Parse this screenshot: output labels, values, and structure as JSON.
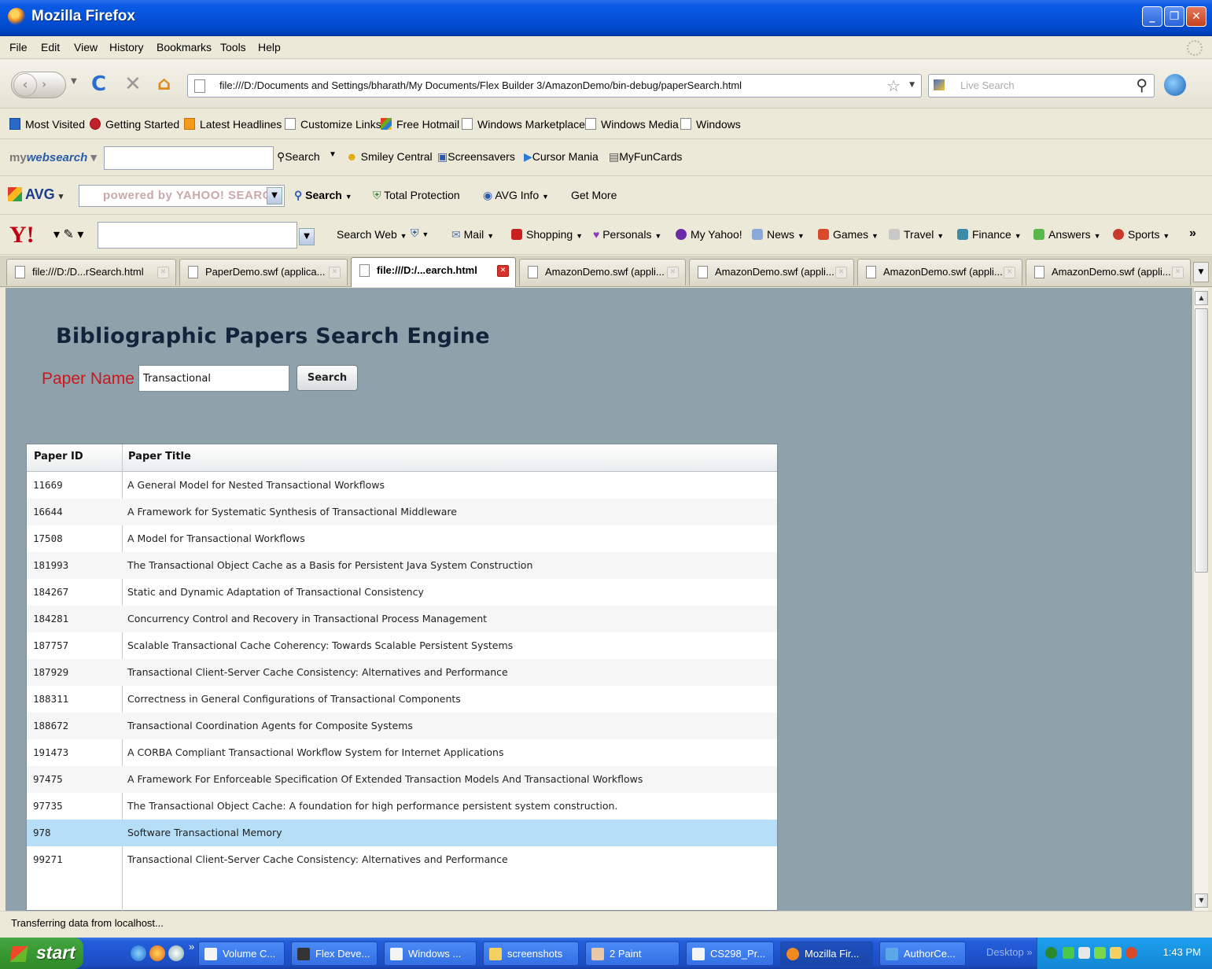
{
  "window": {
    "title": "Mozilla Firefox"
  },
  "menu": [
    "File",
    "Edit",
    "View",
    "History",
    "Bookmarks",
    "Tools",
    "Help"
  ],
  "nav": {
    "url": "file:///D:/Documents and Settings/bharath/My Documents/Flex Builder 3/AmazonDemo/bin-debug/paperSearch.html",
    "search_placeholder": "Live Search"
  },
  "bookmarks": [
    "Most Visited",
    "Getting Started",
    "Latest Headlines",
    "Customize Links",
    "Free Hotmail",
    "Windows Marketplace",
    "Windows Media",
    "Windows"
  ],
  "mywebsearch": {
    "logo_prefix": "my",
    "logo_main": "websearch",
    "search_label": "Search",
    "items": [
      "Smiley Central",
      "Screensavers",
      "Cursor Mania",
      "MyFunCards"
    ]
  },
  "avg": {
    "logo": "AVG",
    "search_placeholder": "powered by YAHOO! SEARCH",
    "search_label": "Search",
    "items": [
      "Total Protection",
      "AVG Info",
      "Get More"
    ]
  },
  "yahoo": {
    "logo": "Y!",
    "search_web": "Search Web",
    "items": [
      "Mail",
      "Shopping",
      "Personals",
      "My Yahoo!",
      "News",
      "Games",
      "Travel",
      "Finance",
      "Answers",
      "Sports"
    ],
    "overflow": "»"
  },
  "tabs": [
    {
      "label": "file:///D:/D...rSearch.html",
      "active": false
    },
    {
      "label": "PaperDemo.swf (applica...",
      "active": false
    },
    {
      "label": "file:///D:/...earch.html",
      "active": true
    },
    {
      "label": "AmazonDemo.swf (appli...",
      "active": false
    },
    {
      "label": "AmazonDemo.swf (appli...",
      "active": false
    },
    {
      "label": "AmazonDemo.swf (appli...",
      "active": false
    },
    {
      "label": "AmazonDemo.swf (appli...",
      "active": false
    }
  ],
  "app": {
    "title": "Bibliographic Papers Search Engine",
    "paper_label": "Paper Name",
    "query": "Transactional",
    "search_button": "Search",
    "columns": [
      "Paper ID",
      "Paper Title"
    ],
    "rows": [
      {
        "id": "11669",
        "title": "A General Model for Nested Transactional Workflows"
      },
      {
        "id": "16644",
        "title": "A Framework for Systematic Synthesis of Transactional Middleware"
      },
      {
        "id": "17508",
        "title": "A Model for Transactional Workflows"
      },
      {
        "id": "181993",
        "title": "The Transactional Object Cache as a Basis for Persistent Java System Construction"
      },
      {
        "id": "184267",
        "title": "Static and Dynamic Adaptation of Transactional Consistency"
      },
      {
        "id": "184281",
        "title": "Concurrency Control and Recovery in Transactional Process Management"
      },
      {
        "id": "187757",
        "title": "Scalable Transactional Cache Coherency: Towards Scalable Persistent Systems"
      },
      {
        "id": "187929",
        "title": "Transactional Client-Server Cache Consistency: Alternatives and Performance"
      },
      {
        "id": "188311",
        "title": "Correctness in General Configurations of Transactional Components"
      },
      {
        "id": "188672",
        "title": "Transactional Coordination Agents for Composite Systems"
      },
      {
        "id": "191473",
        "title": "A CORBA Compliant Transactional Workflow System for Internet Applications"
      },
      {
        "id": "97475",
        "title": "A Framework For Enforceable Specification Of Extended Transaction Models And Transactional Workflows"
      },
      {
        "id": "97735",
        "title": "The Transactional Object Cache: A foundation for high performance persistent system construction."
      },
      {
        "id": "978",
        "title": "Software Transactional Memory",
        "selected": true
      },
      {
        "id": "99271",
        "title": "Transactional Client-Server Cache Consistency: Alternatives and Performance"
      }
    ]
  },
  "status": "Transferring data from localhost...",
  "taskbar": {
    "start": "start",
    "tasks": [
      "Volume C...",
      "Flex Deve...",
      "Windows ...",
      "screenshots",
      "2 Paint",
      "CS298_Pr...",
      "Mozilla Fir...",
      "AuthorCe..."
    ],
    "desktop": "Desktop",
    "clock": "1:43 PM"
  }
}
